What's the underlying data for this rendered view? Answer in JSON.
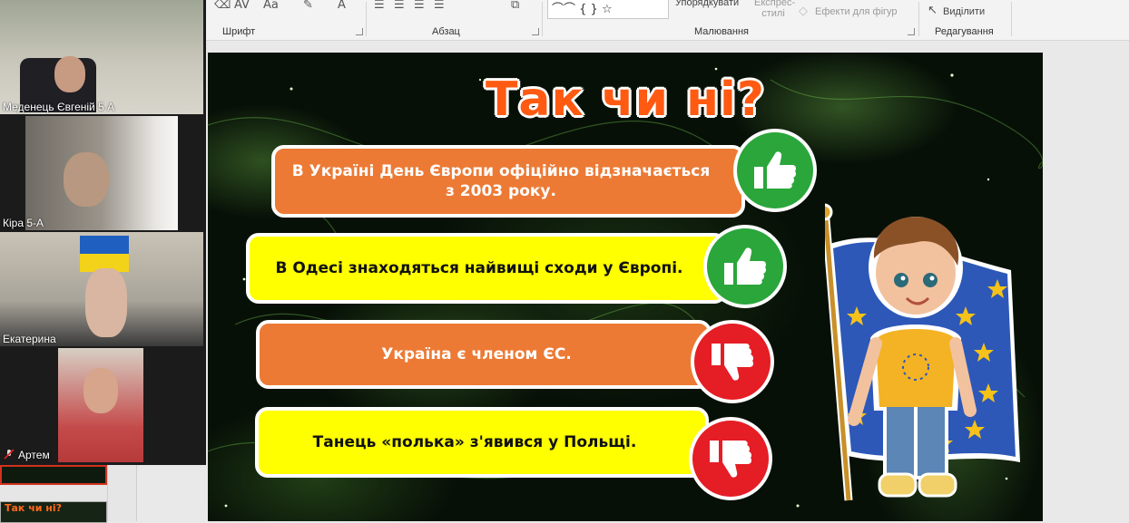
{
  "ribbon": {
    "groups": [
      {
        "label": "Шрифт"
      },
      {
        "label": "Абзац"
      },
      {
        "label": "Малювання"
      },
      {
        "label": "Редагування"
      }
    ],
    "arrange_label": "Упорядкувати",
    "quick_styles_label": "Експрес-стилі",
    "shape_effects_label": "Ефекти для фігур",
    "select_label": "Виділити",
    "font_size_glyph": "Aa",
    "font_color_glyph": "A"
  },
  "participants": [
    {
      "name": "Меденець Євгеній 5 А",
      "muted": false
    },
    {
      "name": "Кіра 5-А",
      "muted": false
    },
    {
      "name": "Екатерина",
      "muted": false
    },
    {
      "name": "Артем",
      "muted": true
    }
  ],
  "thumbnail_title": "Так чи ні?",
  "slide": {
    "title": "Так чи ні?",
    "statements": [
      {
        "text": "В Україні День Європи офіційно відзначається з 2003 року.",
        "answer": "thumbs-up",
        "color": "#ec7a35"
      },
      {
        "text": "В Одесі знаходяться найвищі сходи у Європі.",
        "answer": "thumbs-up",
        "color": "#ffff00"
      },
      {
        "text": "Україна є членом ЄС.",
        "answer": "thumbs-down",
        "color": "#ec7a35"
      },
      {
        "text": "Танець «полька» з'явився у Польщі.",
        "answer": "thumbs-down",
        "color": "#ffff00"
      }
    ],
    "colors": {
      "title": "#ff5a12",
      "green": "#2aa63b",
      "red": "#e51d25"
    }
  }
}
